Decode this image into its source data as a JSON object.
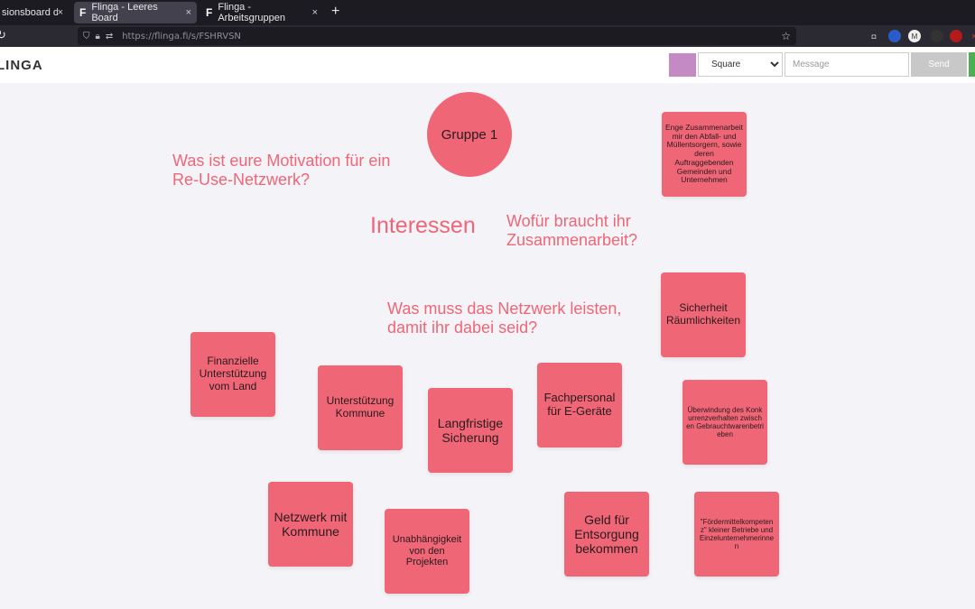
{
  "browser": {
    "tabs": [
      {
        "label": "sionsboard des Re",
        "active": false
      },
      {
        "label": "Flinga - Leeres Board",
        "active": true
      },
      {
        "label": "Flinga - Arbeitsgruppen",
        "active": false
      }
    ],
    "tab_close": "×",
    "new_tab": "+",
    "favicon": "F",
    "url": "https://flinga.fi/s/FSHRVSN"
  },
  "app": {
    "logo": "LINGA",
    "shape_options": [
      "Square"
    ],
    "shape_selected": "Square",
    "message_placeholder": "Message",
    "send_label": "Send",
    "color_swatch": "#c48ac4"
  },
  "board": {
    "circle": "Gruppe 1",
    "q_motivation": "Was ist eure Motivation für ein Re-Use-Netzwerk?",
    "interessen": "Interessen",
    "q_zusammenarbeit": "Wofür braucht ihr Zusammenarbeit?",
    "q_netzwerk": "Was muss das Netzwerk leisten, damit ihr dabei seid?",
    "notes": {
      "enge": "Enge Zusammenarbeit mir den Abfall- und Müllentsorgern, sowie deren Auftraggebenden Gemeinden und Unternehmen",
      "sicherheit": "Sicherheit Räumlichkeiten",
      "finanzielle": "Finanzielle Unterstützung vom Land",
      "unterstuetzung": "Unterstützung Kommune",
      "langfristige": "Langfristige Sicherung",
      "fachpersonal": "Fachpersonal für E-Geräte",
      "ueberwindung": "Überwindung des Konkurrenzverhalten zwischen Gebrauchtwarenbetrieben",
      "netzwerk": "Netzwerk mit Kommune",
      "unabhaengigkeit": "Unabhängigkeit von den Projekten",
      "geld": "Geld für Entsorgung bekommen",
      "foerdermittel": "\"Fördermittelkompetenz\" kleiner Betriebe und Einzelunternehmerinnen"
    },
    "note_color": "#ef6677"
  }
}
